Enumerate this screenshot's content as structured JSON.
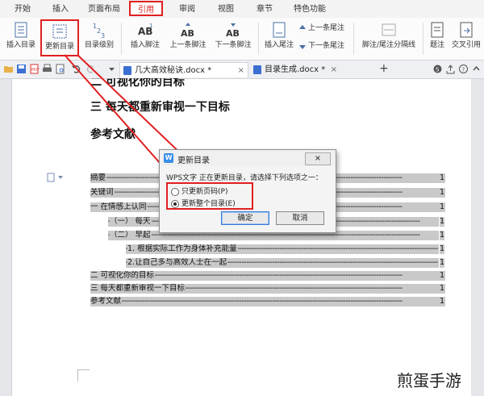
{
  "menu": {
    "tabs": [
      "开始",
      "插入",
      "页面布局",
      "引用",
      "审阅",
      "视图",
      "章节",
      "特色功能"
    ],
    "active": "引用"
  },
  "ribbon": {
    "insert_toc": "插入目录",
    "update_toc": "更新目录",
    "toc_level": "目录级别",
    "insert_footnote": "插入脚注",
    "prev_footnote": "上一条脚注",
    "next_footnote": "下一条脚注",
    "insert_endnote": "插入尾注",
    "prev_endnote": "上一条尾注",
    "next_endnote": "下一条尾注",
    "footnote_separator": "脚注/尾注分隔线",
    "caption": "题注",
    "cross_reference": "交叉引用"
  },
  "doc_tabs": [
    {
      "name": "几大高效秘诀.docx *",
      "close": "×"
    },
    {
      "name": "目录生成.docx *",
      "close": "×"
    }
  ],
  "add_tab": "+",
  "document": {
    "heading_partial": "二 可视化你的目标",
    "heading3": "三 每天都重新审视一下目标",
    "references": "参考文献"
  },
  "toc_entries": [
    {
      "text": "摘要",
      "page": "1"
    },
    {
      "text": "关键词",
      "page": "1"
    },
    {
      "text": "一 在情感上认同",
      "page": "1"
    },
    {
      "text": "（一） 每天",
      "page": "1"
    },
    {
      "text": "（二） 早起",
      "page": "1"
    },
    {
      "text": "1. 根据实际工作为身体补充能量",
      "page": "1"
    },
    {
      "text": "2.让自己多与高效人士在一起",
      "page": "1"
    },
    {
      "text": "二 可视化你的目标",
      "page": "1"
    },
    {
      "text": "三 每天都重新审视一下目标",
      "page": "1"
    },
    {
      "text": "参考文献",
      "page": "1"
    }
  ],
  "dialog": {
    "title": "更新目录",
    "close": "×",
    "message": "WPS文字 正在更新目录，请选择下列选项之一：",
    "option1": "只更新页码(P)",
    "option2": "更新整个目录(E)",
    "selected": "option2",
    "ok": "确定",
    "cancel": "取消"
  },
  "watermark": "煎蛋手游",
  "colors": {
    "highlight": "#e02020",
    "toc_field": "#c9c9c9",
    "accent": "#3a8ee6"
  }
}
